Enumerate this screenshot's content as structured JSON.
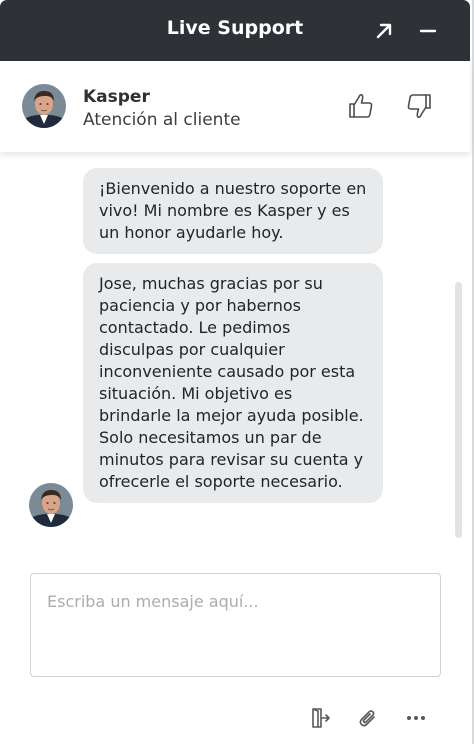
{
  "header": {
    "title": "Live Support",
    "bg_color": "#2e3236",
    "expand_icon": "arrow-up-right-icon",
    "minimize_icon": "minus-icon"
  },
  "agent": {
    "name": "Kasper",
    "role": "Atención al cliente",
    "thumbs_up_icon": "thumbs-up-icon",
    "thumbs_down_icon": "thumbs-down-icon"
  },
  "messages": [
    {
      "text": "¡Bienvenido a nuestro soporte en vivo! Mi nombre es Kasper y es un honor ayudarle hoy."
    },
    {
      "text": "Jose, muchas gracias por su paciencia y por habernos contactado. Le pedimos disculpas por cualquier inconveniente causado por esta situación. Mi objetivo es brindarle la mejor ayuda posible. Solo necesitamos un par de minutos para revisar su cuenta y ofrecerle el soporte necesario."
    }
  ],
  "composer": {
    "placeholder": "Escriba un mensaje aquí..."
  },
  "footer": {
    "end_chat_icon": "exit-door-icon",
    "attach_icon": "paperclip-icon",
    "more_icon": "more-dots-icon"
  },
  "colors": {
    "bubble_bg": "#e9eaeb",
    "text": "#222428"
  }
}
